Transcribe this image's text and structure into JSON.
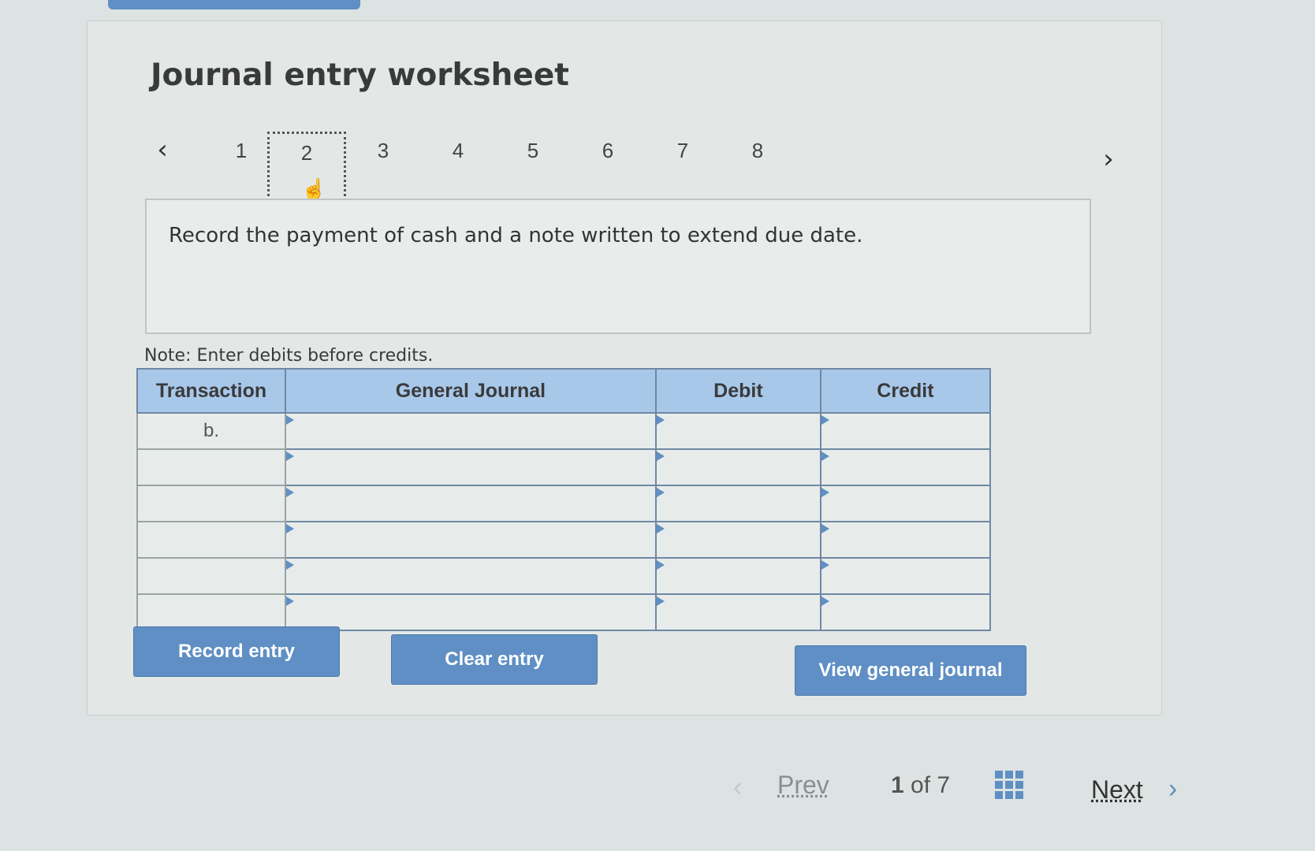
{
  "worksheet": {
    "title": "Journal entry worksheet",
    "steps": [
      "1",
      "2",
      "3",
      "4",
      "5",
      "6",
      "7",
      "8"
    ],
    "active_step": "2",
    "question": "Record the payment of cash and a note written to extend due date.",
    "note": "Note: Enter debits before credits."
  },
  "table": {
    "headers": {
      "transaction": "Transaction",
      "general_journal": "General Journal",
      "debit": "Debit",
      "credit": "Credit"
    },
    "first_transaction": "b."
  },
  "buttons": {
    "record": "Record entry",
    "clear": "Clear entry",
    "view": "View general journal"
  },
  "footer": {
    "prev": "Prev",
    "page_current": "1",
    "page_of": "of",
    "page_total": "7",
    "next": "Next"
  },
  "colors": {
    "accent": "#5f8fc4",
    "header": "#a8c8ea"
  }
}
